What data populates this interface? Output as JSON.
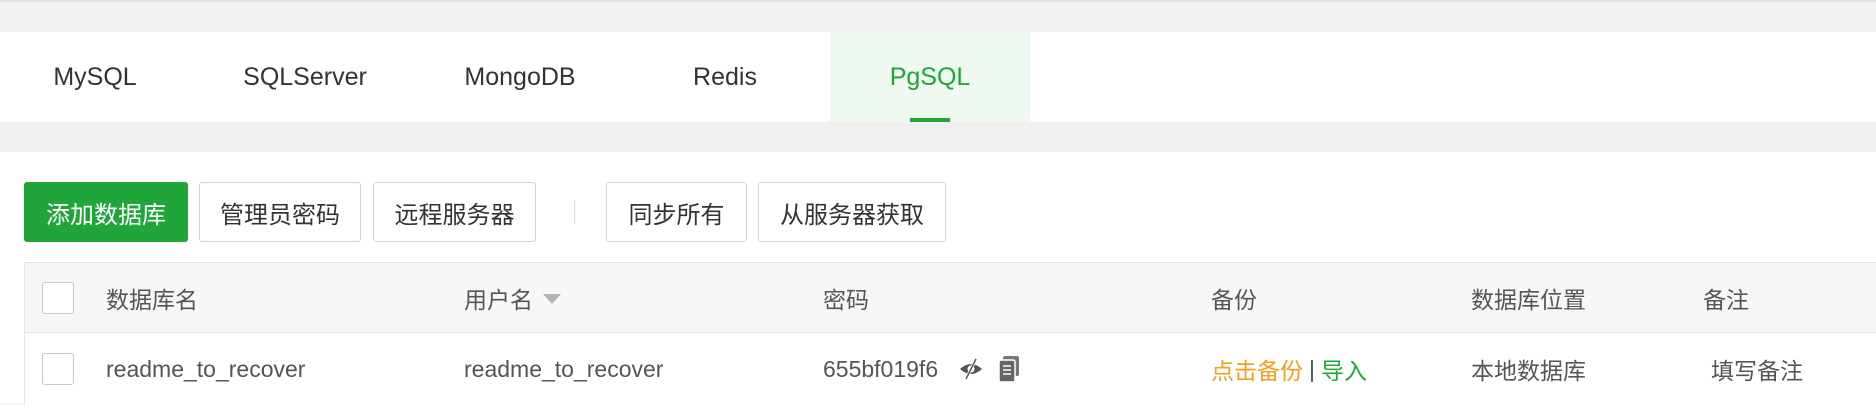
{
  "tabs": [
    {
      "label": "MySQL",
      "active": false
    },
    {
      "label": "SQLServer",
      "active": false
    },
    {
      "label": "MongoDB",
      "active": false
    },
    {
      "label": "Redis",
      "active": false
    },
    {
      "label": "PgSQL",
      "active": true
    }
  ],
  "toolbar": {
    "add_database": "添加数据库",
    "admin_password": "管理员密码",
    "remote_server": "远程服务器",
    "sync_all": "同步所有",
    "fetch_from_server": "从服务器获取"
  },
  "table": {
    "columns": {
      "db_name": "数据库名",
      "username": "用户名",
      "password": "密码",
      "backup": "备份",
      "location": "数据库位置",
      "note": "备注"
    },
    "rows": [
      {
        "db_name": "readme_to_recover",
        "username": "readme_to_recover",
        "password": "655bf019f6",
        "backup_action": "点击备份",
        "backup_sep": "|",
        "import_action": "导入",
        "location": "本地数据库",
        "note": "填写备注"
      }
    ]
  },
  "colors": {
    "brand_green": "#20a53a",
    "backup_orange": "#f0a020",
    "active_tab_bg": "#eff9ef"
  },
  "icons": {
    "toggle_password": "eye-slash-icon",
    "copy_password": "copy-icon",
    "sort": "caret-down-icon"
  }
}
